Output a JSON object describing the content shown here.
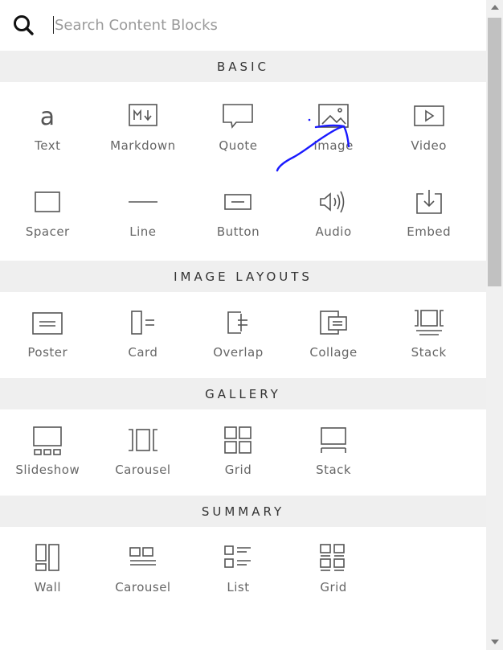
{
  "search": {
    "placeholder": "Search Content Blocks",
    "value": ""
  },
  "sections": [
    {
      "title": "BASIC",
      "items": [
        {
          "label": "Text",
          "icon": "text-icon"
        },
        {
          "label": "Markdown",
          "icon": "markdown-icon"
        },
        {
          "label": "Quote",
          "icon": "quote-icon"
        },
        {
          "label": "Image",
          "icon": "image-icon"
        },
        {
          "label": "Video",
          "icon": "video-icon"
        },
        {
          "label": "Spacer",
          "icon": "spacer-icon"
        },
        {
          "label": "Line",
          "icon": "line-icon"
        },
        {
          "label": "Button",
          "icon": "button-icon"
        },
        {
          "label": "Audio",
          "icon": "audio-icon"
        },
        {
          "label": "Embed",
          "icon": "embed-icon"
        }
      ]
    },
    {
      "title": "IMAGE LAYOUTS",
      "items": [
        {
          "label": "Poster",
          "icon": "poster-icon"
        },
        {
          "label": "Card",
          "icon": "card-icon"
        },
        {
          "label": "Overlap",
          "icon": "overlap-icon"
        },
        {
          "label": "Collage",
          "icon": "collage-icon"
        },
        {
          "label": "Stack",
          "icon": "stack-icon"
        }
      ]
    },
    {
      "title": "GALLERY",
      "items": [
        {
          "label": "Slideshow",
          "icon": "slideshow-icon"
        },
        {
          "label": "Carousel",
          "icon": "carousel-icon"
        },
        {
          "label": "Grid",
          "icon": "grid-icon"
        },
        {
          "label": "Stack",
          "icon": "gallery-stack-icon"
        }
      ]
    },
    {
      "title": "SUMMARY",
      "items": [
        {
          "label": "Wall",
          "icon": "wall-icon"
        },
        {
          "label": "Carousel",
          "icon": "summary-carousel-icon"
        },
        {
          "label": "List",
          "icon": "list-icon"
        },
        {
          "label": "Grid",
          "icon": "summary-grid-icon"
        }
      ]
    }
  ],
  "colors": {
    "section_bg": "#efefef",
    "icon": "#555555",
    "annotation": "#1a1aff"
  }
}
